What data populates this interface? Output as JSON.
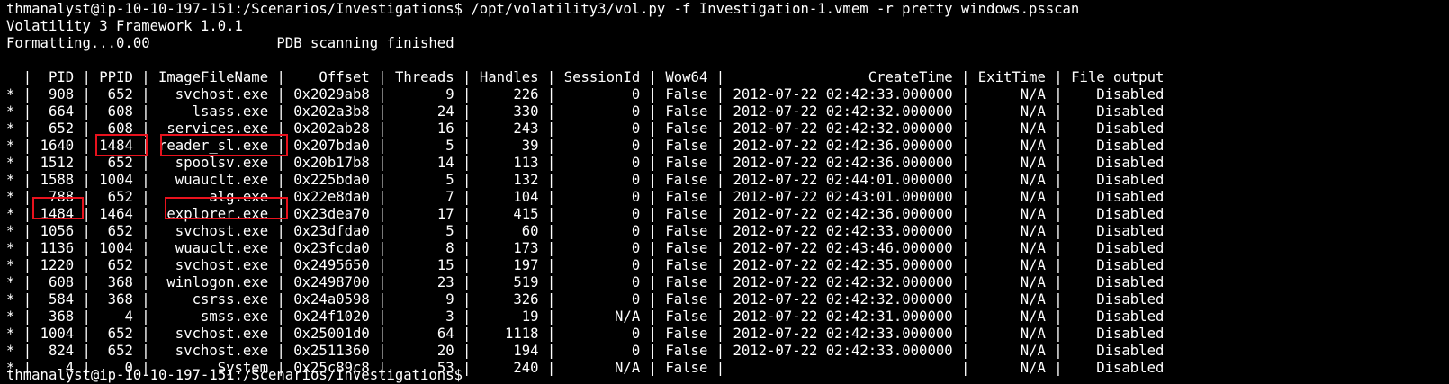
{
  "terminal": {
    "command_line": "thmanalyst@ip-10-10-197-151:/Scenarios/Investigations$ /opt/volatility3/vol.py -f Investigation-1.vmem -r pretty windows.psscan",
    "banner": "Volatility 3 Framework 1.0.1",
    "progress_line": "Formatting...0.00               PDB scanning finished",
    "last_prompt": "thmanalyst@ip-10-10-197-151:/Scenarios/Investigations$ "
  },
  "table": {
    "columns": [
      "",
      "PID",
      "PPID",
      "ImageFileName",
      "Offset",
      "Threads",
      "Handles",
      "SessionId",
      "Wow64",
      "CreateTime",
      "ExitTime",
      "File output"
    ],
    "rows": [
      [
        "*",
        "908",
        "652",
        "svchost.exe",
        "0x2029ab8",
        "9",
        "226",
        "0",
        "False",
        "2012-07-22 02:42:33.000000",
        "N/A",
        "Disabled"
      ],
      [
        "*",
        "664",
        "608",
        "lsass.exe",
        "0x202a3b8",
        "24",
        "330",
        "0",
        "False",
        "2012-07-22 02:42:32.000000",
        "N/A",
        "Disabled"
      ],
      [
        "*",
        "652",
        "608",
        "services.exe",
        "0x202ab28",
        "16",
        "243",
        "0",
        "False",
        "2012-07-22 02:42:32.000000",
        "N/A",
        "Disabled"
      ],
      [
        "*",
        "1640",
        "1484",
        "reader_sl.exe",
        "0x207bda0",
        "5",
        "39",
        "0",
        "False",
        "2012-07-22 02:42:36.000000",
        "N/A",
        "Disabled"
      ],
      [
        "*",
        "1512",
        "652",
        "spoolsv.exe",
        "0x20b17b8",
        "14",
        "113",
        "0",
        "False",
        "2012-07-22 02:42:36.000000",
        "N/A",
        "Disabled"
      ],
      [
        "*",
        "1588",
        "1004",
        "wuauclt.exe",
        "0x225bda0",
        "5",
        "132",
        "0",
        "False",
        "2012-07-22 02:44:01.000000",
        "N/A",
        "Disabled"
      ],
      [
        "*",
        "788",
        "652",
        "alg.exe",
        "0x22e8da0",
        "7",
        "104",
        "0",
        "False",
        "2012-07-22 02:43:01.000000",
        "N/A",
        "Disabled"
      ],
      [
        "*",
        "1484",
        "1464",
        "explorer.exe",
        "0x23dea70",
        "17",
        "415",
        "0",
        "False",
        "2012-07-22 02:42:36.000000",
        "N/A",
        "Disabled"
      ],
      [
        "*",
        "1056",
        "652",
        "svchost.exe",
        "0x23dfda0",
        "5",
        "60",
        "0",
        "False",
        "2012-07-22 02:42:33.000000",
        "N/A",
        "Disabled"
      ],
      [
        "*",
        "1136",
        "1004",
        "wuauclt.exe",
        "0x23fcda0",
        "8",
        "173",
        "0",
        "False",
        "2012-07-22 02:43:46.000000",
        "N/A",
        "Disabled"
      ],
      [
        "*",
        "1220",
        "652",
        "svchost.exe",
        "0x2495650",
        "15",
        "197",
        "0",
        "False",
        "2012-07-22 02:42:35.000000",
        "N/A",
        "Disabled"
      ],
      [
        "*",
        "608",
        "368",
        "winlogon.exe",
        "0x2498700",
        "23",
        "519",
        "0",
        "False",
        "2012-07-22 02:42:32.000000",
        "N/A",
        "Disabled"
      ],
      [
        "*",
        "584",
        "368",
        "csrss.exe",
        "0x24a0598",
        "9",
        "326",
        "0",
        "False",
        "2012-07-22 02:42:32.000000",
        "N/A",
        "Disabled"
      ],
      [
        "*",
        "368",
        "4",
        "smss.exe",
        "0x24f1020",
        "3",
        "19",
        "N/A",
        "False",
        "2012-07-22 02:42:31.000000",
        "N/A",
        "Disabled"
      ],
      [
        "*",
        "1004",
        "652",
        "svchost.exe",
        "0x25001d0",
        "64",
        "1118",
        "0",
        "False",
        "2012-07-22 02:42:33.000000",
        "N/A",
        "Disabled"
      ],
      [
        "*",
        "824",
        "652",
        "svchost.exe",
        "0x2511360",
        "20",
        "194",
        "0",
        "False",
        "2012-07-22 02:42:33.000000",
        "N/A",
        "Disabled"
      ],
      [
        "*",
        "4",
        "0",
        "System",
        "0x25c89c8",
        "53",
        "240",
        "N/A",
        "False",
        "",
        "N/A",
        "Disabled"
      ]
    ]
  },
  "colors": {
    "background": "#000000",
    "text": "#ffffff",
    "highlight_box": "#e8121d"
  }
}
